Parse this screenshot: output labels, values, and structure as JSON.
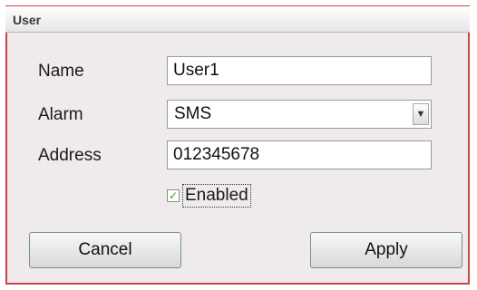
{
  "dialog": {
    "title": "User",
    "name_label": "Name",
    "name_value": "User1",
    "alarm_label": "Alarm",
    "alarm_value": "SMS",
    "address_label": "Address",
    "address_value": "012345678",
    "enabled_label": "Enabled",
    "enabled_checked": true,
    "cancel_label": "Cancel",
    "apply_label": "Apply"
  },
  "icons": {
    "dropdown": "chevron-down-icon",
    "check": "checkmark-icon"
  }
}
